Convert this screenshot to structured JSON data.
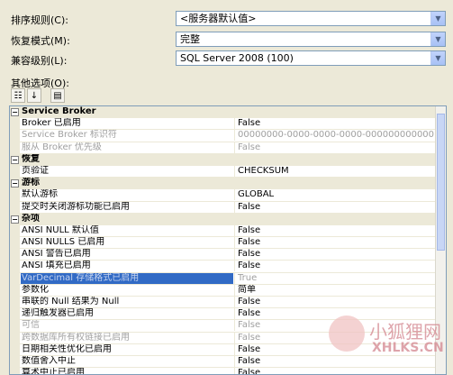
{
  "form": {
    "collation_label": "排序规则(C):",
    "collation_value": "<服务器默认值>",
    "recovery_label": "恢复模式(M):",
    "recovery_value": "完整",
    "compat_label": "兼容级别(L):",
    "compat_value": "SQL Server 2008 (100)",
    "other_label": "其他选项(O):"
  },
  "toolbar": {
    "categorized_icon": "categorized-icon",
    "alphabetical_icon": "alphabetical-icon",
    "property_pages_icon": "property-pages-icon"
  },
  "grid": {
    "rows": [
      {
        "type": "category",
        "name": "Service Broker"
      },
      {
        "type": "prop",
        "name": "Broker 已启用",
        "value": "False",
        "disabled": false
      },
      {
        "type": "prop",
        "name": "Service Broker 标识符",
        "value": "00000000-0000-0000-0000-000000000000",
        "disabled": true
      },
      {
        "type": "prop",
        "name": "服从 Broker 优先级",
        "value": "False",
        "disabled": true
      },
      {
        "type": "category",
        "name": "恢复"
      },
      {
        "type": "prop",
        "name": "页验证",
        "value": "CHECKSUM",
        "disabled": false
      },
      {
        "type": "category",
        "name": "游标"
      },
      {
        "type": "prop",
        "name": "默认游标",
        "value": "GLOBAL",
        "disabled": false
      },
      {
        "type": "prop",
        "name": "提交时关闭游标功能已启用",
        "value": "False",
        "disabled": false
      },
      {
        "type": "category",
        "name": "杂项"
      },
      {
        "type": "prop",
        "name": "ANSI NULL 默认值",
        "value": "False",
        "disabled": false
      },
      {
        "type": "prop",
        "name": "ANSI NULLS 已启用",
        "value": "False",
        "disabled": false
      },
      {
        "type": "prop",
        "name": "ANSI 警告已启用",
        "value": "False",
        "disabled": false
      },
      {
        "type": "prop",
        "name": "ANSI 填充已启用",
        "value": "False",
        "disabled": false
      },
      {
        "type": "prop",
        "name": "VarDecimal 存储格式已启用",
        "value": "True",
        "disabled": true,
        "selected": true
      },
      {
        "type": "prop",
        "name": "参数化",
        "value": "简单",
        "disabled": false
      },
      {
        "type": "prop",
        "name": "串联的 Null 结果为 Null",
        "value": "False",
        "disabled": false
      },
      {
        "type": "prop",
        "name": "递归触发器已启用",
        "value": "False",
        "disabled": false
      },
      {
        "type": "prop",
        "name": "可信",
        "value": "False",
        "disabled": true
      },
      {
        "type": "prop",
        "name": "跨数据库所有权链接已启用",
        "value": "False",
        "disabled": true
      },
      {
        "type": "prop",
        "name": "日期相关性优化已启用",
        "value": "False",
        "disabled": false
      },
      {
        "type": "prop",
        "name": "数值舍入中止",
        "value": "False",
        "disabled": false
      },
      {
        "type": "prop",
        "name": "算术中止已启用",
        "value": "False",
        "disabled": false
      }
    ]
  },
  "watermark": {
    "line1": "小狐狸网",
    "line2": "XHLKS.CN"
  }
}
